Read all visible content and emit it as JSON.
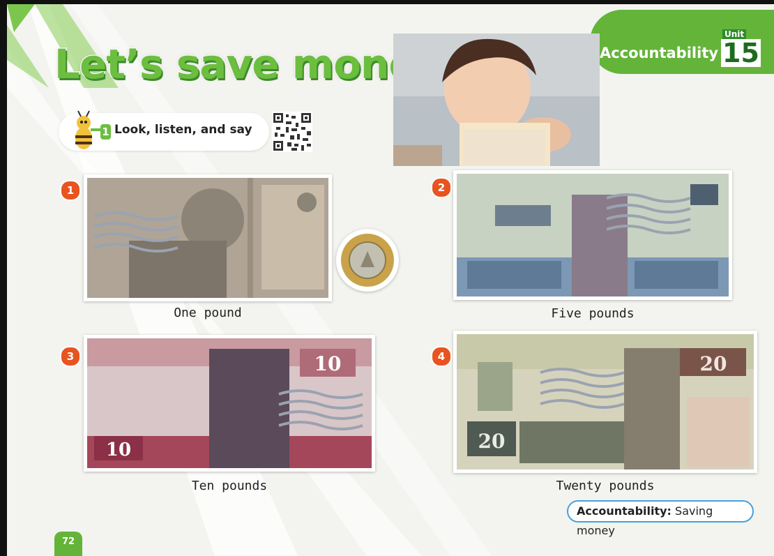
{
  "title": "Let’s save money",
  "unit_tab": {
    "value_name": "Accountability",
    "unit_word": "Unit",
    "unit_number": "15"
  },
  "activity": {
    "number": "1",
    "instruction": "Look, listen, and say"
  },
  "notes": [
    {
      "index": "1",
      "caption": "One pound",
      "icon": "one-pound-banknote"
    },
    {
      "index": "2",
      "caption": "Five pounds",
      "icon": "five-pounds-banknote"
    },
    {
      "index": "3",
      "caption": "Ten pounds",
      "icon": "ten-pounds-banknote"
    },
    {
      "index": "4",
      "caption": "Twenty pounds",
      "icon": "twenty-pounds-banknote"
    }
  ],
  "note_numerals": {
    "ten": "10",
    "twenty": "20"
  },
  "value_box": {
    "label": "Accountability:",
    "text": "Saving money"
  },
  "page_number": "72",
  "colors": {
    "brand_green": "#64b43a",
    "badge_orange": "#e8541f",
    "pill_border": "#49a0d8"
  }
}
